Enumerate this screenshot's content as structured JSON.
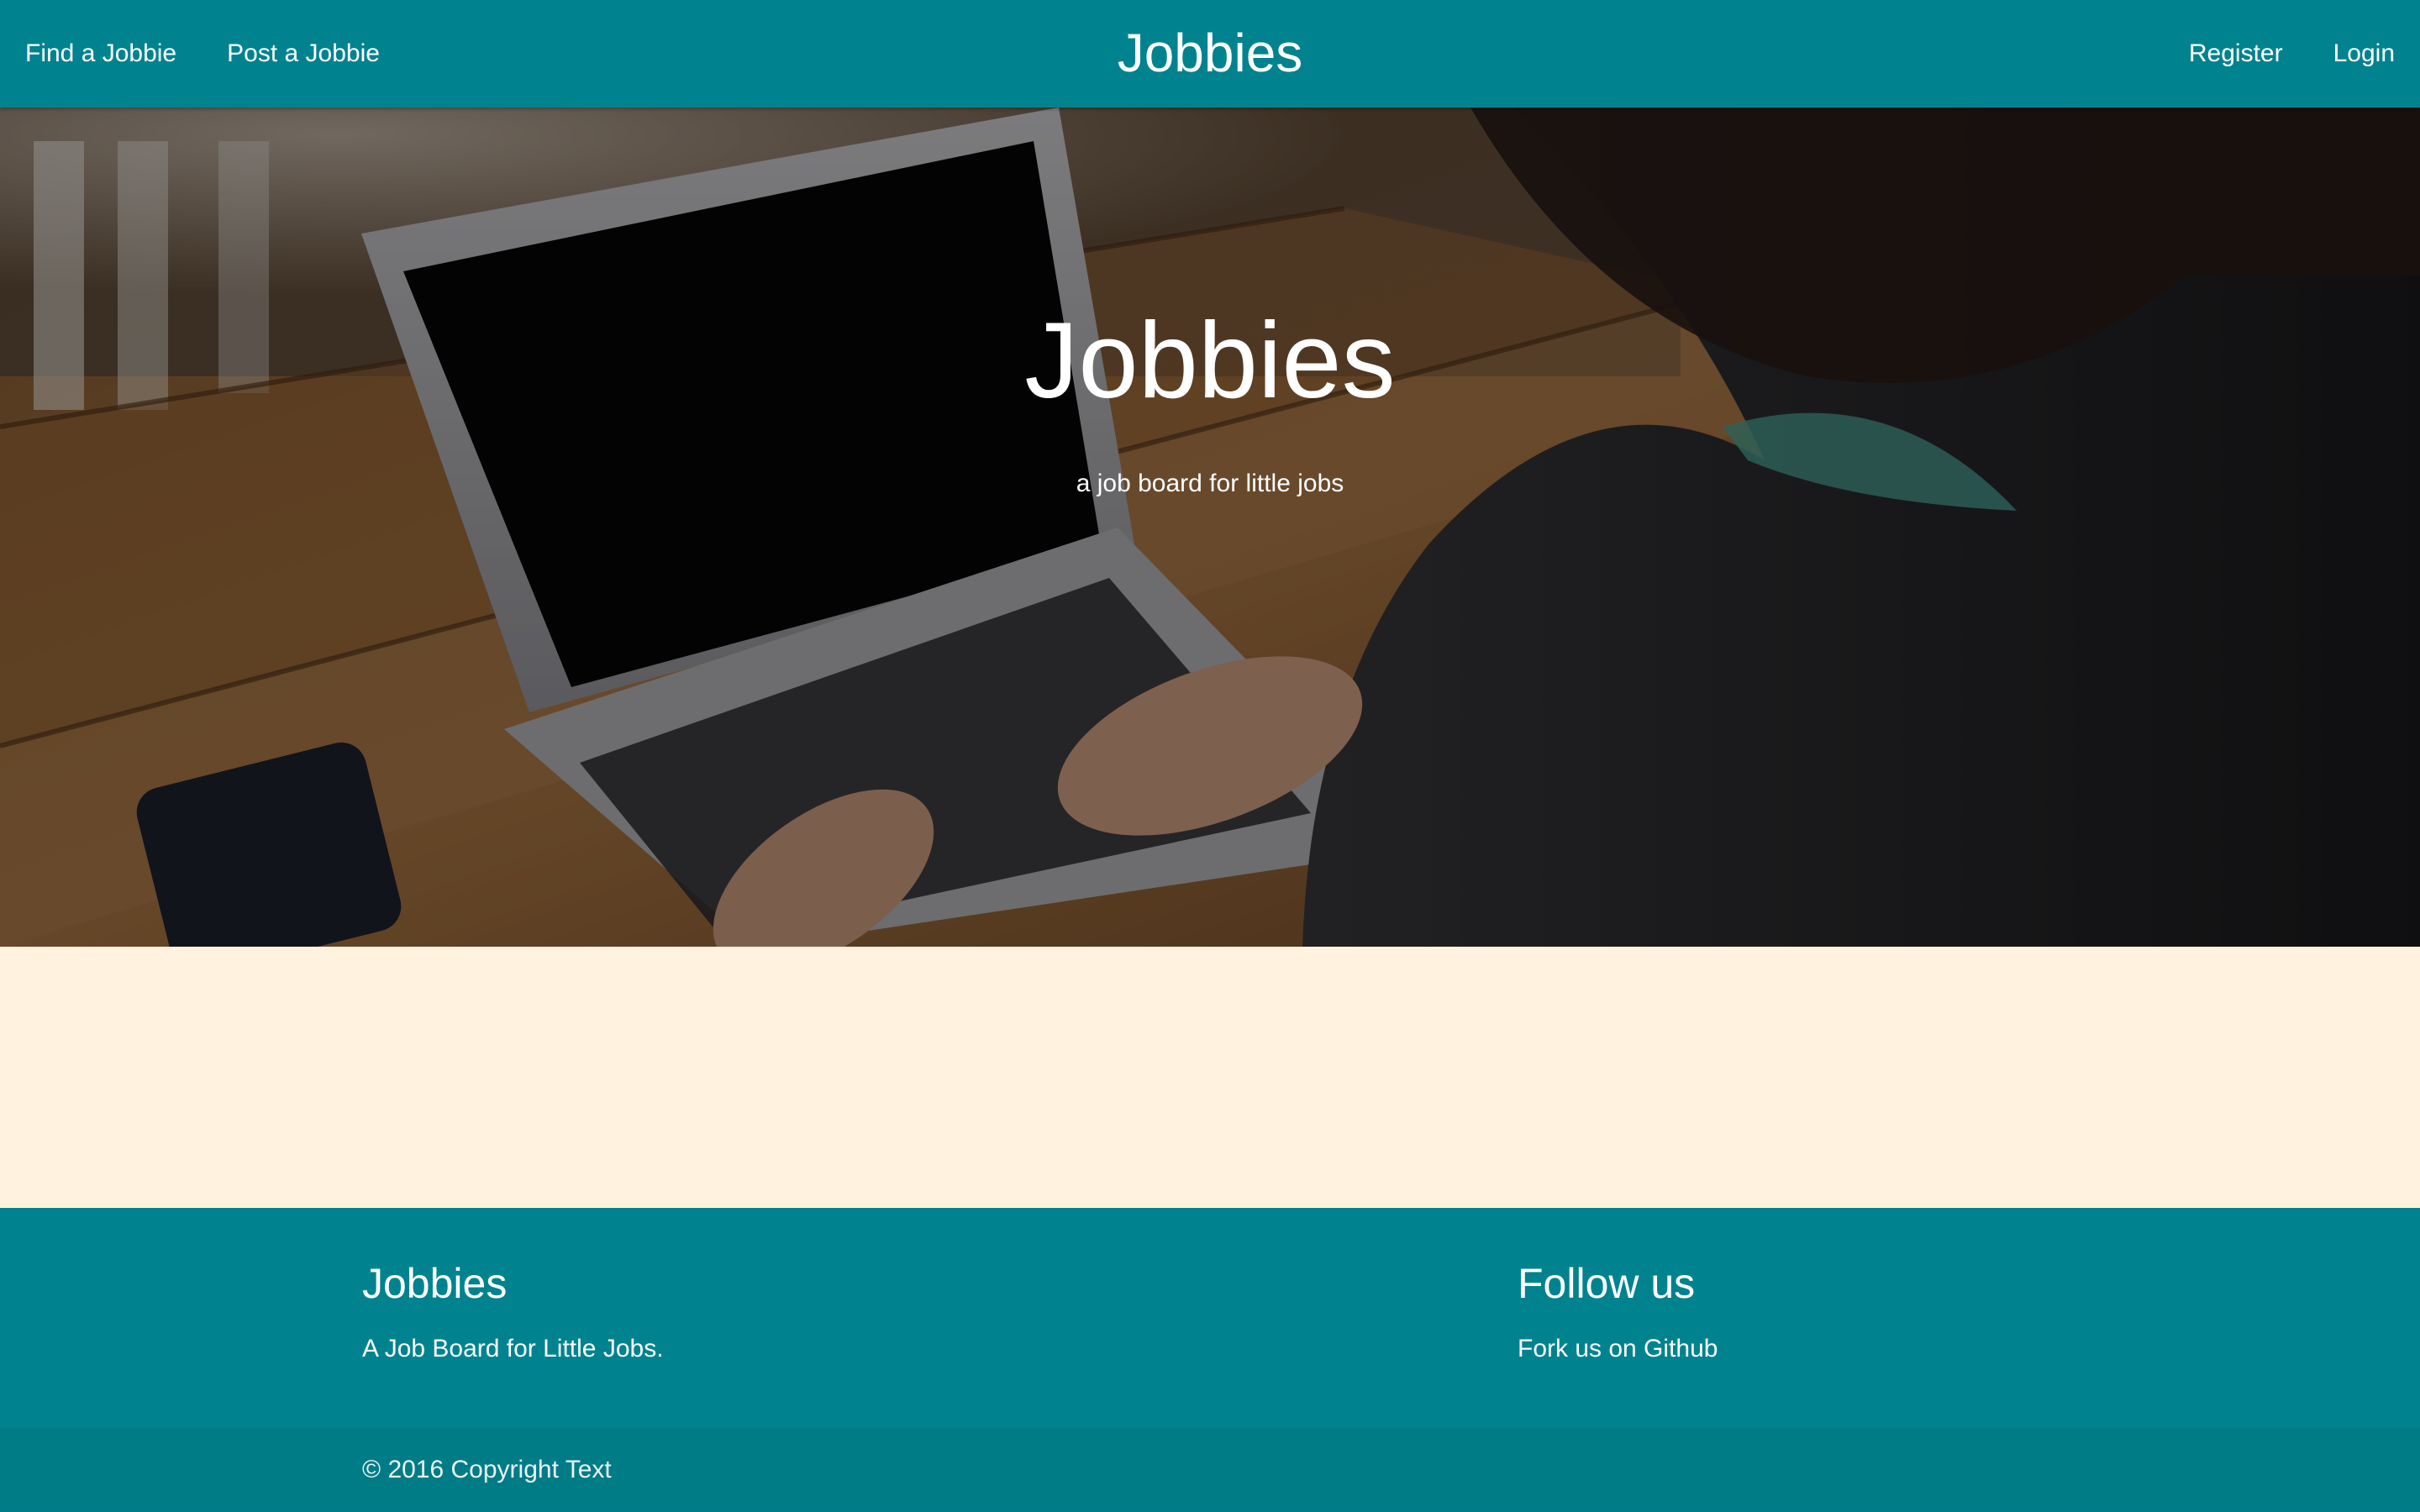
{
  "colors": {
    "primary": "#00838f",
    "page_background": "#fff3e0",
    "text_on_primary": "#ffffff"
  },
  "navbar": {
    "brand": "Jobbies",
    "left_links": [
      "Find a Jobbie",
      "Post a Jobbie"
    ],
    "right_links": [
      "Register",
      "Login"
    ]
  },
  "hero": {
    "title": "Jobbies",
    "subtitle": "a job board for little jobs"
  },
  "footer": {
    "left": {
      "heading": "Jobbies",
      "text": "A Job Board for Little Jobs."
    },
    "right": {
      "heading": "Follow us",
      "link": "Fork us on Github"
    },
    "copyright": "© 2016 Copyright Text"
  }
}
